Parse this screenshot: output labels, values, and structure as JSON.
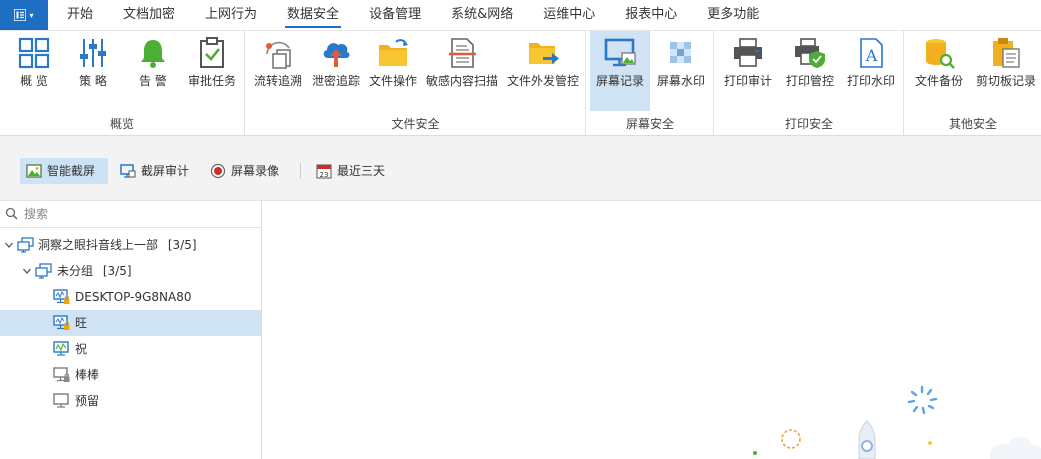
{
  "menubar": {
    "tabs": [
      "开始",
      "文档加密",
      "上网行为",
      "数据安全",
      "设备管理",
      "系统&网络",
      "运维中心",
      "报表中心",
      "更多功能"
    ],
    "active_index": 3
  },
  "ribbon": {
    "groups": [
      {
        "label": "概览",
        "items": [
          "概 览",
          "策 略",
          "告 警",
          "审批任务"
        ]
      },
      {
        "label": "文件安全",
        "items": [
          "流转追溯",
          "泄密追踪",
          "文件操作",
          "敏感内容扫描",
          "文件外发管控"
        ]
      },
      {
        "label": "屏幕安全",
        "items": [
          "屏幕记录",
          "屏幕水印"
        ]
      },
      {
        "label": "打印安全",
        "items": [
          "打印审计",
          "打印管控",
          "打印水印"
        ]
      },
      {
        "label": "其他安全",
        "items": [
          "文件备份",
          "剪切板记录"
        ]
      }
    ],
    "active_item": "屏幕记录"
  },
  "subtoolbar": {
    "smart_capture": "智能截屏",
    "capture_audit": "截屏审计",
    "screen_record": "屏幕录像",
    "date_range": "最近三天",
    "calendar_day": "23"
  },
  "tree": {
    "search_placeholder": "搜索",
    "root": {
      "label": "洞察之眼抖音线上一部",
      "count": "[3/5]"
    },
    "group": {
      "label": "未分组",
      "count": "[3/5]"
    },
    "computers": [
      {
        "label": "DESKTOP-9G8NA80",
        "status": "online-locked"
      },
      {
        "label": "旺",
        "status": "online-locked"
      },
      {
        "label": "祝",
        "status": "online"
      },
      {
        "label": "棒棒",
        "status": "offline-locked"
      },
      {
        "label": "预留",
        "status": "offline"
      }
    ],
    "selected_index": 1
  },
  "colors": {
    "accent": "#1e6fc4",
    "selected_bg": "#cfe3f5",
    "online": "#2a78c8",
    "offline": "#7a7a7a",
    "lock": "#f0a500"
  }
}
